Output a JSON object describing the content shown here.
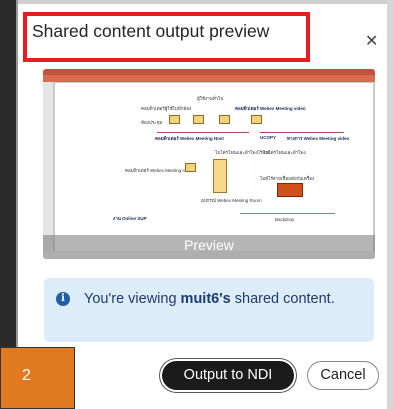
{
  "dialog": {
    "title": "Shared content output preview",
    "close_icon": "close-icon"
  },
  "preview": {
    "label": "Preview",
    "slide": {
      "t1": "ผู้ใช้งานทั่วไป",
      "t2": "คอมพิวเตอร์ผู้ใช้ไม่มีกล้อง",
      "t3": "คอมพิวเตอร์ Webex Meeting video",
      "t4": "ห้องประชุม",
      "t5": "คอมพิวเตอร์ Webex Meeting Host",
      "t6": "UCOPY",
      "t7": "ทางการ Webex Meeting video",
      "t8": "ไมโครโฟนและลำโพงไร้สาย",
      "t9": "คอมพิวเตอร์ Webex Meeting Host",
      "t10": "ไมโครโฟนและลำโพง",
      "t11": "อุปกรณ์ Webex Meeting Room",
      "t12": "ไมค์ไร้สายเชื่อมต่อกับเครื่อง",
      "t13": "งาน Online SUP",
      "t14": "Backdrop"
    }
  },
  "info": {
    "icon": "info-icon",
    "prefix": "You're viewing",
    "user": "muit6's",
    "suffix": "shared content."
  },
  "badge": {
    "number": "2"
  },
  "buttons": {
    "output_label": "Output to NDI",
    "cancel_label": "Cancel"
  }
}
